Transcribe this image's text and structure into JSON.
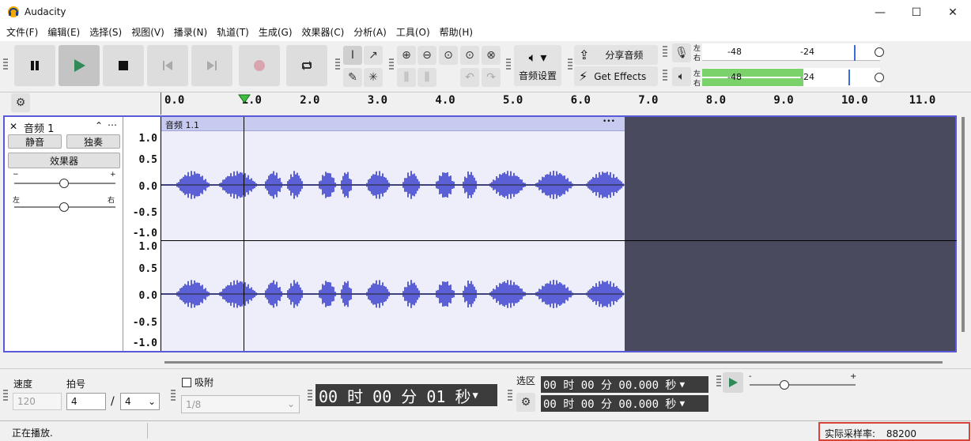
{
  "app": {
    "title": "Audacity"
  },
  "menu": [
    "文件(F)",
    "编辑(E)",
    "选择(S)",
    "视图(V)",
    "播录(N)",
    "轨道(T)",
    "生成(G)",
    "效果器(C)",
    "分析(A)",
    "工具(O)",
    "帮助(H)"
  ],
  "toolbar": {
    "audio_setup_label": "音频设置",
    "share_audio_label": "分享音频",
    "get_effects_label": "Get Effects",
    "meter_left": "左",
    "meter_right": "右",
    "meter_ticks": [
      "-48",
      "-24"
    ],
    "play_meter_level": 0.57
  },
  "timeline": {
    "ticks": [
      "0.0",
      "1.0",
      "2.0",
      "3.0",
      "4.0",
      "5.0",
      "6.0",
      "7.0",
      "8.0",
      "9.0",
      "10.0",
      "11.0"
    ]
  },
  "track": {
    "name": "音频 1",
    "mute_label": "静音",
    "solo_label": "独奏",
    "effects_label": "效果器",
    "gain_minus": "−",
    "gain_plus": "+",
    "pan_left": "左",
    "pan_right": "右",
    "clip_name": "音频 1.1",
    "clip_menu": "•••",
    "scale": [
      "1.0",
      "0.5",
      "0.0",
      "-0.5",
      "-1.0"
    ]
  },
  "bottom": {
    "tempo_label": "速度",
    "tempo_value": "120",
    "meter_label": "拍号",
    "meter_top": "4",
    "meter_slash": "/",
    "meter_bottom": "4",
    "snap_label": "吸附",
    "snap_value": "1/8",
    "time_display": "00 时 00 分 01 秒",
    "selection_label": "选区",
    "sel_start": "00 时 00 分 00.000 秒",
    "sel_end": "00 时 00 分 00.000 秒",
    "speed_minus": "-",
    "speed_plus": "+"
  },
  "status": {
    "left": "正在播放.",
    "rate_label": "实际采样率:",
    "rate_value": "88200"
  },
  "colors": {
    "waveform": "#5c60d6",
    "clip_bg": "#eeeefb",
    "meter_green": "#7bd26b",
    "status_box": "#d9443a"
  }
}
